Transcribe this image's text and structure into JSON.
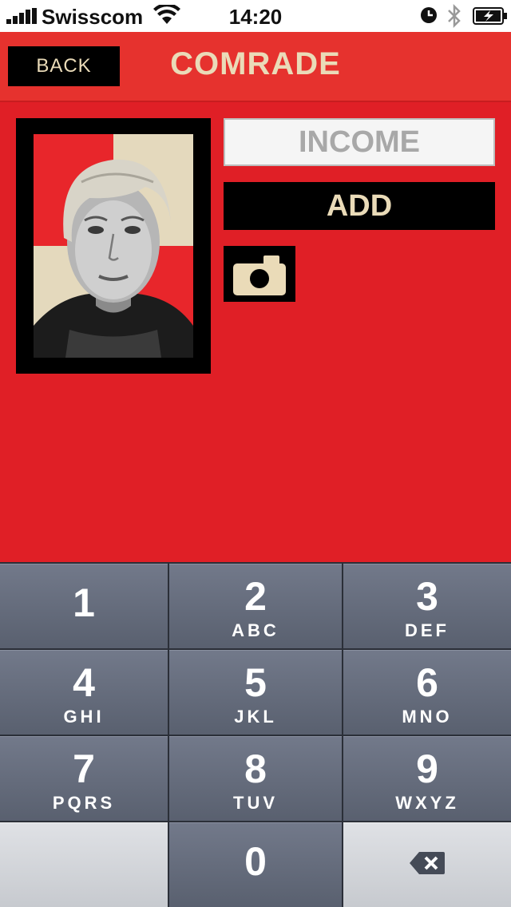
{
  "status_bar": {
    "carrier": "Swisscom",
    "time": "14:20",
    "icons": [
      "signal-icon",
      "wifi-icon",
      "alarm-icon",
      "bluetooth-icon",
      "battery-charging-icon"
    ]
  },
  "nav": {
    "back_label": "BACK",
    "title": "COMRADE"
  },
  "form": {
    "income_placeholder": "INCOME",
    "income_value": "",
    "add_label": "ADD",
    "camera_icon": "camera-icon"
  },
  "colors": {
    "background": "#e01f26",
    "accent_text": "#eadbb8",
    "button_bg": "#000000"
  },
  "keypad": {
    "keys": [
      {
        "num": "1",
        "letters": ""
      },
      {
        "num": "2",
        "letters": "ABC"
      },
      {
        "num": "3",
        "letters": "DEF"
      },
      {
        "num": "4",
        "letters": "GHI"
      },
      {
        "num": "5",
        "letters": "JKL"
      },
      {
        "num": "6",
        "letters": "MNO"
      },
      {
        "num": "7",
        "letters": "PQRS"
      },
      {
        "num": "8",
        "letters": "TUV"
      },
      {
        "num": "9",
        "letters": "WXYZ"
      },
      {
        "num": "0",
        "letters": ""
      }
    ],
    "delete_icon": "backspace-icon"
  }
}
